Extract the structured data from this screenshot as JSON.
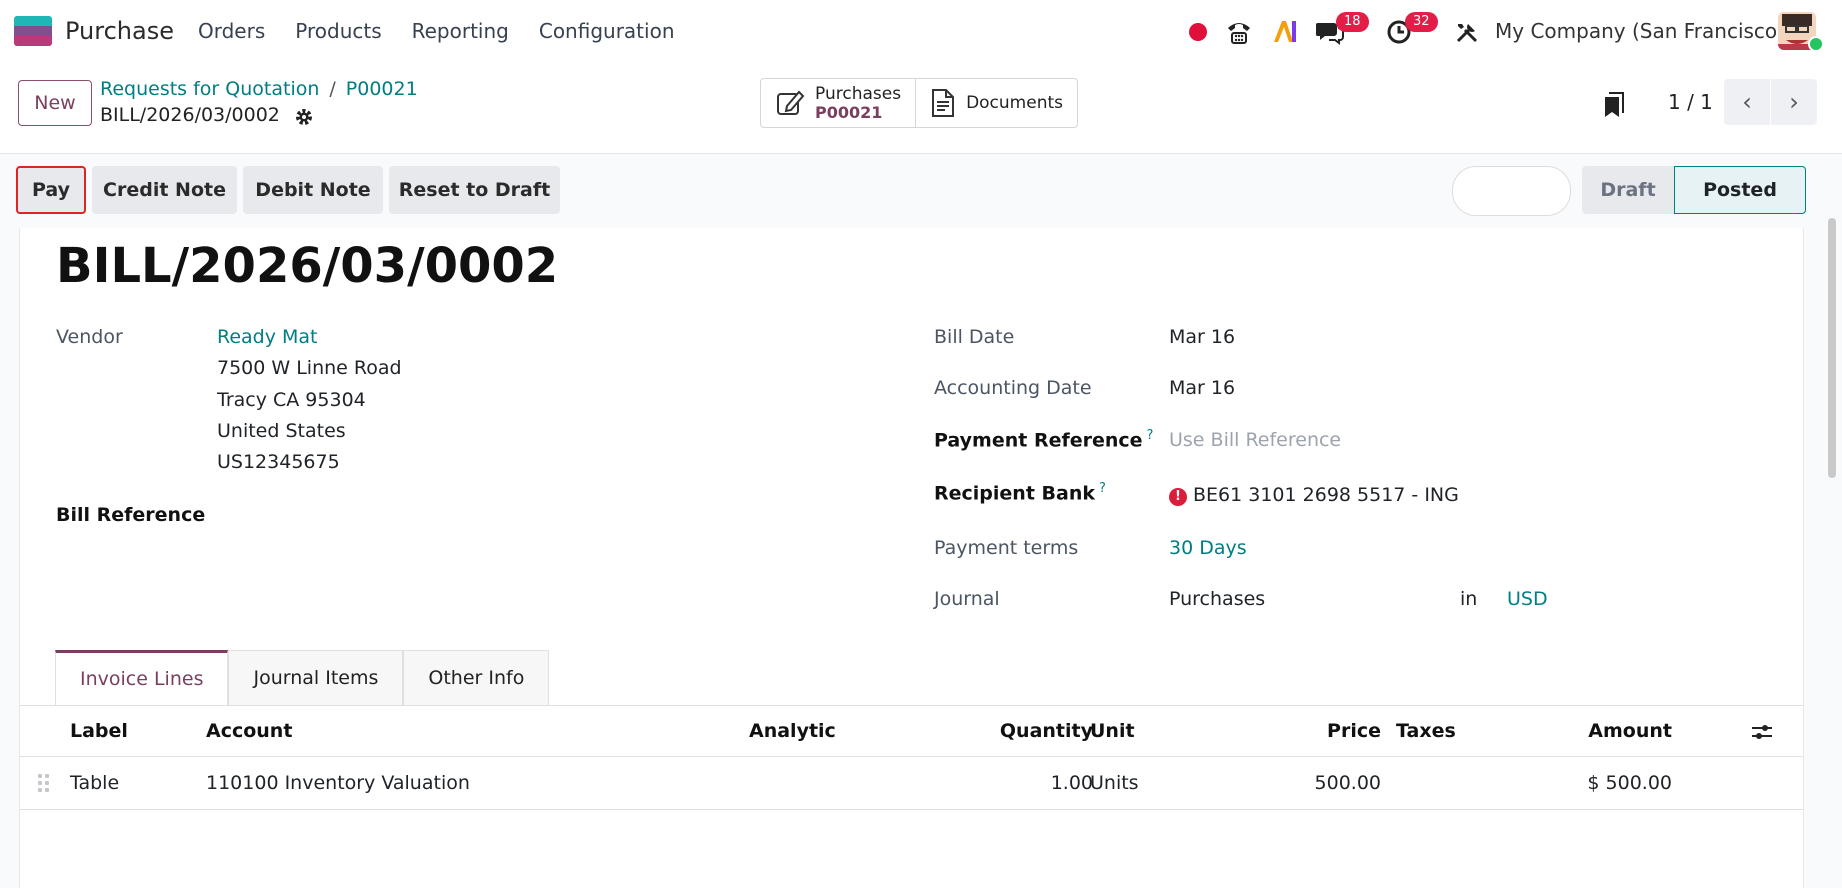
{
  "nav": {
    "app_name": "Purchase",
    "menu": [
      "Orders",
      "Products",
      "Reporting",
      "Configuration"
    ],
    "messages_count": "18",
    "activities_count": "32",
    "company": "My Company (San Francisco)"
  },
  "control_panel": {
    "new_label": "New",
    "breadcrumb_parent": "Requests for Quotation",
    "breadcrumb_sep": "/",
    "breadcrumb_order": "P00021",
    "record_name": "BILL/2026/03/0002",
    "smart_purchases_label": "Purchases",
    "smart_purchases_value": "P00021",
    "smart_documents_label": "Documents",
    "pager": "1 / 1"
  },
  "actions": {
    "pay": "Pay",
    "credit_note": "Credit Note",
    "debit_note": "Debit Note",
    "reset_to_draft": "Reset to Draft",
    "status_draft": "Draft",
    "status_posted": "Posted"
  },
  "form": {
    "title": "BILL/2026/03/0002",
    "vendor_label": "Vendor",
    "vendor_name": "Ready Mat",
    "vendor_address_1": "7500 W Linne Road",
    "vendor_address_2": "Tracy CA 95304",
    "vendor_address_3": "United States",
    "vendor_vat": "US12345675",
    "bill_reference_label": "Bill Reference",
    "bill_date_label": "Bill Date",
    "bill_date": "Mar 16",
    "accounting_date_label": "Accounting Date",
    "accounting_date": "Mar 16",
    "payment_reference_label": "Payment Reference",
    "payment_reference_placeholder": "Use Bill Reference",
    "recipient_bank_label": "Recipient Bank",
    "recipient_bank": "BE61 3101 2698 5517 - ING",
    "payment_terms_label": "Payment terms",
    "payment_terms": "30 Days",
    "journal_label": "Journal",
    "journal": "Purchases",
    "journal_in": "in",
    "currency": "USD"
  },
  "tabs": [
    "Invoice Lines",
    "Journal Items",
    "Other Info"
  ],
  "table": {
    "headers": {
      "label": "Label",
      "account": "Account",
      "analytic": "Analytic",
      "quantity": "Quantity",
      "unit": "Unit",
      "price": "Price",
      "taxes": "Taxes",
      "amount": "Amount"
    },
    "rows": [
      {
        "label": "Table",
        "account": "110100 Inventory Valuation",
        "quantity": "1.00",
        "unit": "Units",
        "price": "500.00",
        "amount": "$ 500.00"
      }
    ]
  },
  "colors": {
    "brand": "#7a3f5f",
    "link": "#017e84",
    "badge": "#e11d48"
  }
}
